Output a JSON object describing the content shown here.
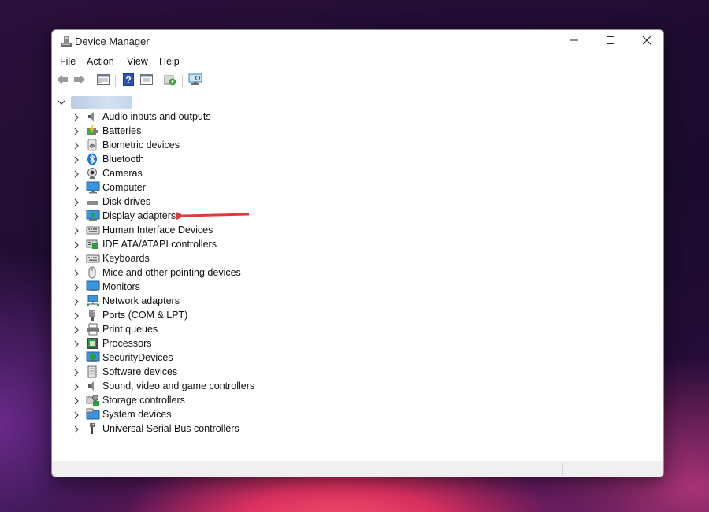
{
  "window": {
    "title": "Device Manager"
  },
  "menu": [
    "File",
    "Action",
    "View",
    "Help"
  ],
  "toolbar": [
    {
      "icon": "back-arrow-icon"
    },
    {
      "icon": "forward-arrow-icon"
    },
    {
      "icon": "show-hide-console-tree-icon"
    },
    {
      "icon": "help-icon"
    },
    {
      "icon": "properties-icon"
    },
    {
      "icon": "update-driver-icon"
    },
    {
      "icon": "scan-hardware-icon"
    }
  ],
  "tree": {
    "root": {
      "label": "",
      "expanded": true
    },
    "nodes": [
      {
        "label": "Audio inputs and outputs",
        "icon": "speaker-icon"
      },
      {
        "label": "Batteries",
        "icon": "battery-icon"
      },
      {
        "label": "Biometric devices",
        "icon": "fingerprint-icon"
      },
      {
        "label": "Bluetooth",
        "icon": "bluetooth-icon"
      },
      {
        "label": "Cameras",
        "icon": "camera-icon"
      },
      {
        "label": "Computer",
        "icon": "computer-icon"
      },
      {
        "label": "Disk drives",
        "icon": "disk-drive-icon"
      },
      {
        "label": "Display adapters",
        "icon": "display-adapter-icon"
      },
      {
        "label": "Human Interface Devices",
        "icon": "hid-icon"
      },
      {
        "label": "IDE ATA/ATAPI controllers",
        "icon": "ide-controller-icon"
      },
      {
        "label": "Keyboards",
        "icon": "keyboard-icon"
      },
      {
        "label": "Mice and other pointing devices",
        "icon": "mouse-icon"
      },
      {
        "label": "Monitors",
        "icon": "monitor-icon"
      },
      {
        "label": "Network adapters",
        "icon": "network-adapter-icon"
      },
      {
        "label": "Ports (COM & LPT)",
        "icon": "port-icon"
      },
      {
        "label": "Print queues",
        "icon": "printer-icon"
      },
      {
        "label": "Processors",
        "icon": "processor-icon"
      },
      {
        "label": "SecurityDevices",
        "icon": "security-device-icon"
      },
      {
        "label": "Software devices",
        "icon": "software-device-icon"
      },
      {
        "label": "Sound, video and game controllers",
        "icon": "sound-controller-icon"
      },
      {
        "label": "Storage controllers",
        "icon": "storage-controller-icon"
      },
      {
        "label": "System devices",
        "icon": "system-device-icon"
      },
      {
        "label": "Universal Serial Bus controllers",
        "icon": "usb-icon"
      }
    ]
  },
  "annotation": {
    "target": "Display adapters",
    "color": "#e0393e"
  }
}
